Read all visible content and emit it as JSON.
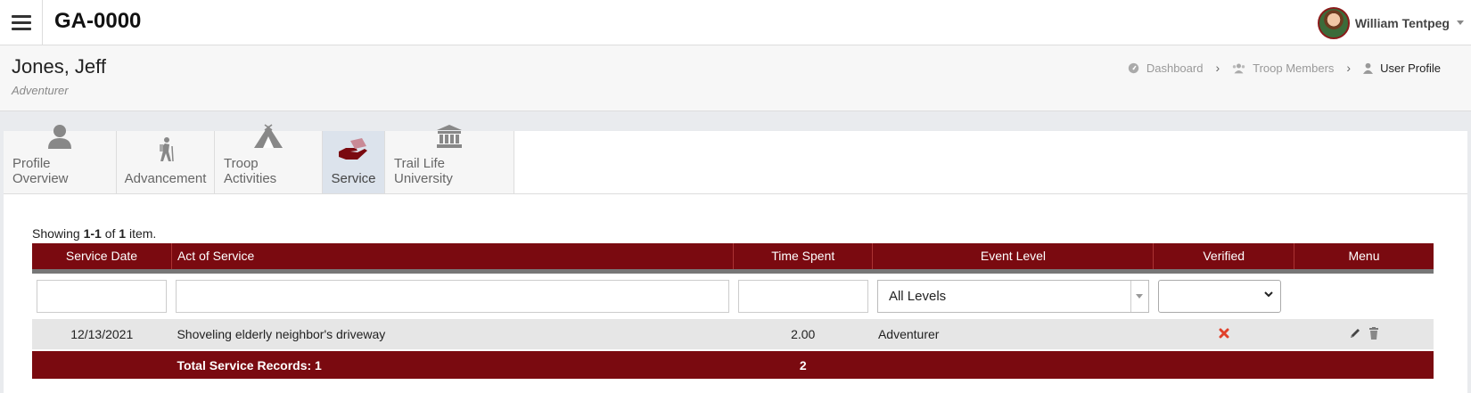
{
  "app": {
    "title": "GA-0000"
  },
  "user": {
    "name": "William Tentpeg"
  },
  "profile": {
    "name": "Jones, Jeff",
    "role": "Adventurer"
  },
  "breadcrumb": [
    {
      "label": "Dashboard",
      "icon": "dashboard-icon"
    },
    {
      "label": "Troop Members",
      "icon": "users-icon"
    },
    {
      "label": "User Profile",
      "icon": "user-icon"
    }
  ],
  "tabs": [
    {
      "label": "Profile Overview",
      "icon": "person-icon"
    },
    {
      "label": "Advancement",
      "icon": "hiker-icon"
    },
    {
      "label": "Troop Activities",
      "icon": "tent-icon"
    },
    {
      "label": "Service",
      "icon": "helping-hand-icon",
      "active": true
    },
    {
      "label": "Trail Life University",
      "icon": "university-icon"
    }
  ],
  "summary": {
    "prefix": "Showing ",
    "range": "1-1",
    "of": " of ",
    "count": "1",
    "suffix": " item."
  },
  "table": {
    "columns": [
      "Service Date",
      "Act of Service",
      "Time Spent",
      "Event Level",
      "Verified",
      "Menu"
    ],
    "filters": {
      "event_level": "All Levels",
      "verified": ""
    },
    "rows": [
      {
        "date": "12/13/2021",
        "act": "Shoveling elderly neighbor's driveway",
        "time": "2.00",
        "level": "Adventurer",
        "verified": false
      }
    ],
    "footer": {
      "label": "Total Service Records: 1",
      "total_time": "2"
    }
  },
  "colors": {
    "brand": "#7a0a10",
    "verified_false": "#e0402a"
  }
}
